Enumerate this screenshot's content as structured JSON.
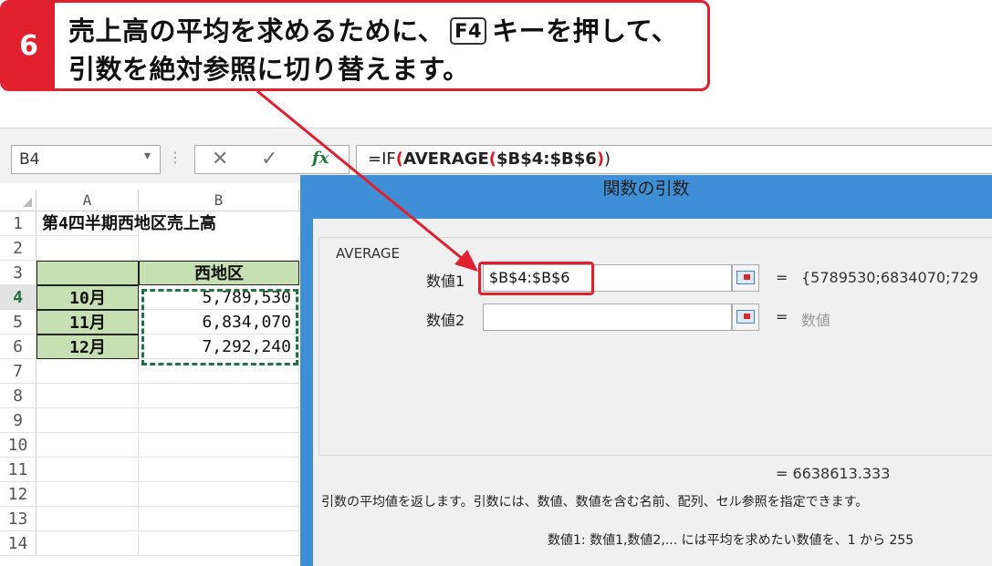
{
  "callout": {
    "step_number": "6",
    "line1_before_key": "売上高の平均を求めるために、",
    "key_label": "F4",
    "line1_after_key": "キーを押して、",
    "line2": "引数を絶対参照に切り替えます。"
  },
  "formula_bar": {
    "name_box": "B4",
    "cancel_icon": "✕",
    "enter_icon": "✓",
    "fx_label": "fx",
    "formula_prefix": "=IF",
    "formula_func": "AVERAGE",
    "formula_range": "$B$4:$B$6",
    "formula_suffix": ")"
  },
  "sheet": {
    "columns": [
      "A",
      "B"
    ],
    "row_numbers": [
      "1",
      "2",
      "3",
      "4",
      "5",
      "6",
      "7",
      "8",
      "9",
      "10",
      "11",
      "12",
      "13",
      "14"
    ],
    "title": "第4四半期西地区売上高",
    "header_b": "西地区",
    "rows": [
      {
        "month": "10月",
        "value": "5,789,530"
      },
      {
        "month": "11月",
        "value": "6,834,070"
      },
      {
        "month": "12月",
        "value": "7,292,240"
      }
    ],
    "colors": {
      "header_fill": "#c6e0b4",
      "marquee": "#217346",
      "selected_row": "#217346"
    }
  },
  "dialog": {
    "title": "関数の引数",
    "function_name": "AVERAGE",
    "arg1_label": "数値1",
    "arg1_value": "$B$4:$B$6",
    "arg1_result": "{5789530;6834070;729",
    "arg2_label": "数値2",
    "arg2_value": "",
    "arg2_result": "数値",
    "equals": "=",
    "total_result": "=  6638613.333",
    "description": "引数の平均値を返します。引数には、数値、数値を含む名前、配列、セル参照を指定できます。",
    "arg_description": "数値1:  数値1,数値2,... には平均を求めたい数値を、1 から 255",
    "colors": {
      "title_bar": "#3f8fd6",
      "highlight": "#e0202e"
    }
  },
  "icons": {
    "ref_button": "collapse-dialog-icon",
    "dropdown": "chevron-down-icon"
  }
}
